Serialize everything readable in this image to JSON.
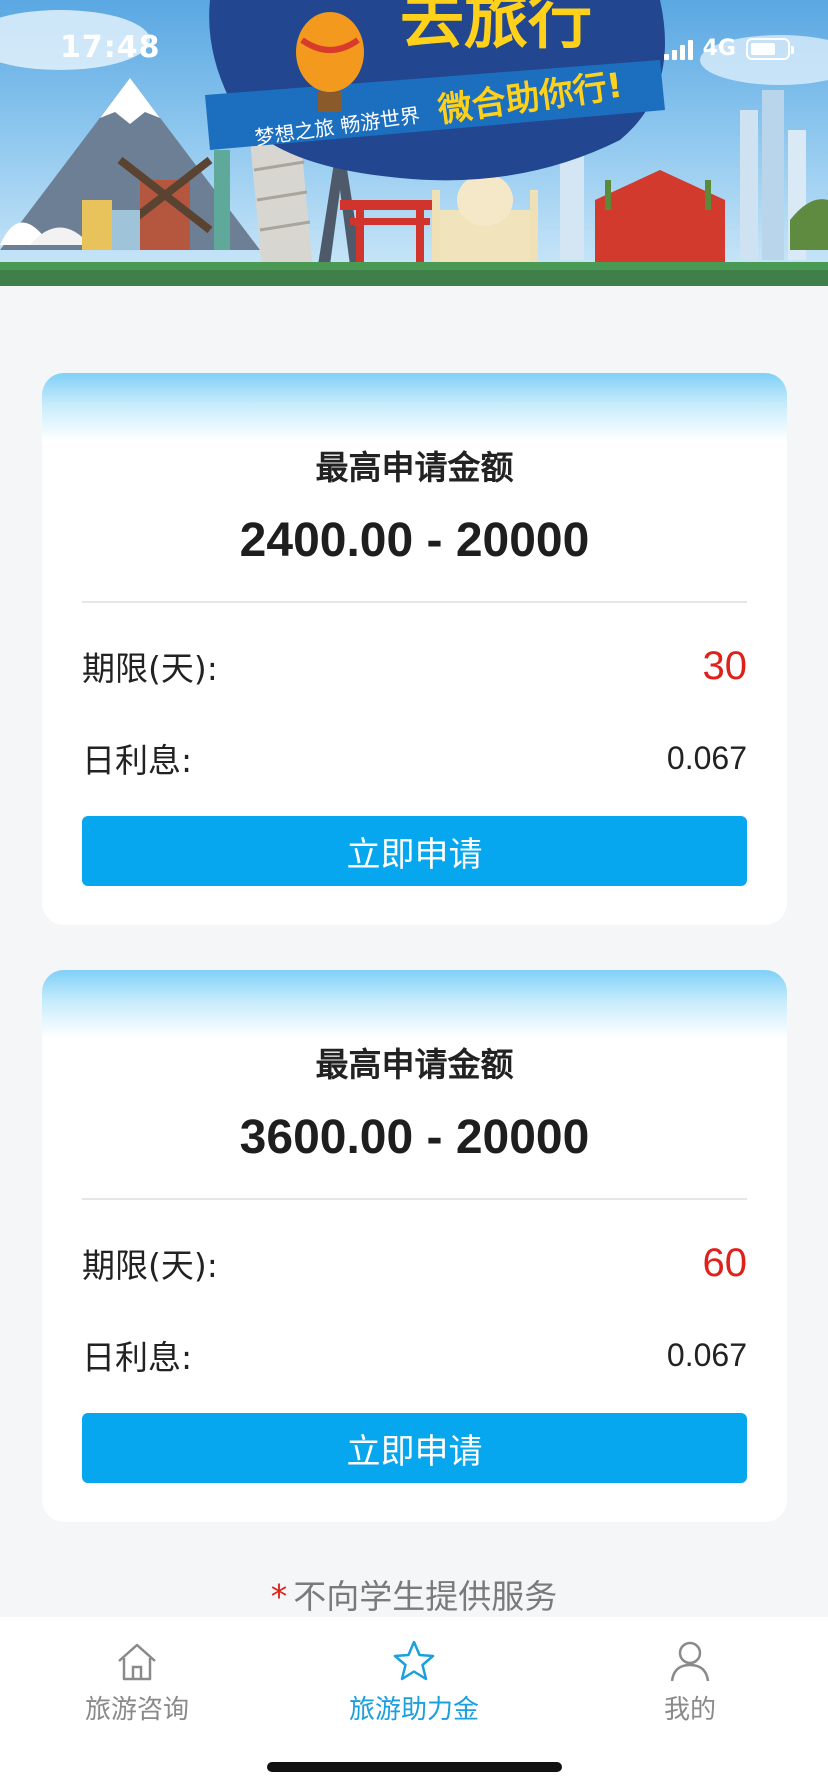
{
  "status_bar": {
    "time": "17:48",
    "network": "4G"
  },
  "banner": {
    "headline": "去旅行",
    "slogan_left": "梦想之旅 畅游世界",
    "slogan_right": "微合助你行!"
  },
  "cards": [
    {
      "title": "最高申请金额",
      "amount": "2400.00 - 20000",
      "term_label": "期限(天):",
      "term_value": "30",
      "rate_label": "日利息:",
      "rate_value": "0.067",
      "button_label": "立即申请"
    },
    {
      "title": "最高申请金额",
      "amount": "3600.00 - 20000",
      "term_label": "期限(天):",
      "term_value": "60",
      "rate_label": "日利息:",
      "rate_value": "0.067",
      "button_label": "立即申请"
    }
  ],
  "notice": {
    "marker": "*",
    "text": "不向学生提供服务"
  },
  "tab_bar": {
    "items": [
      {
        "label": "旅游咨询",
        "icon": "home-icon",
        "active": false
      },
      {
        "label": "旅游助力金",
        "icon": "star-icon",
        "active": true
      },
      {
        "label": "我的",
        "icon": "user-icon",
        "active": false
      }
    ]
  },
  "colors": {
    "accent": "#06a7ef",
    "tab_active": "#1aa0de",
    "term_value": "#e0201a",
    "background": "#f5f6f8"
  }
}
